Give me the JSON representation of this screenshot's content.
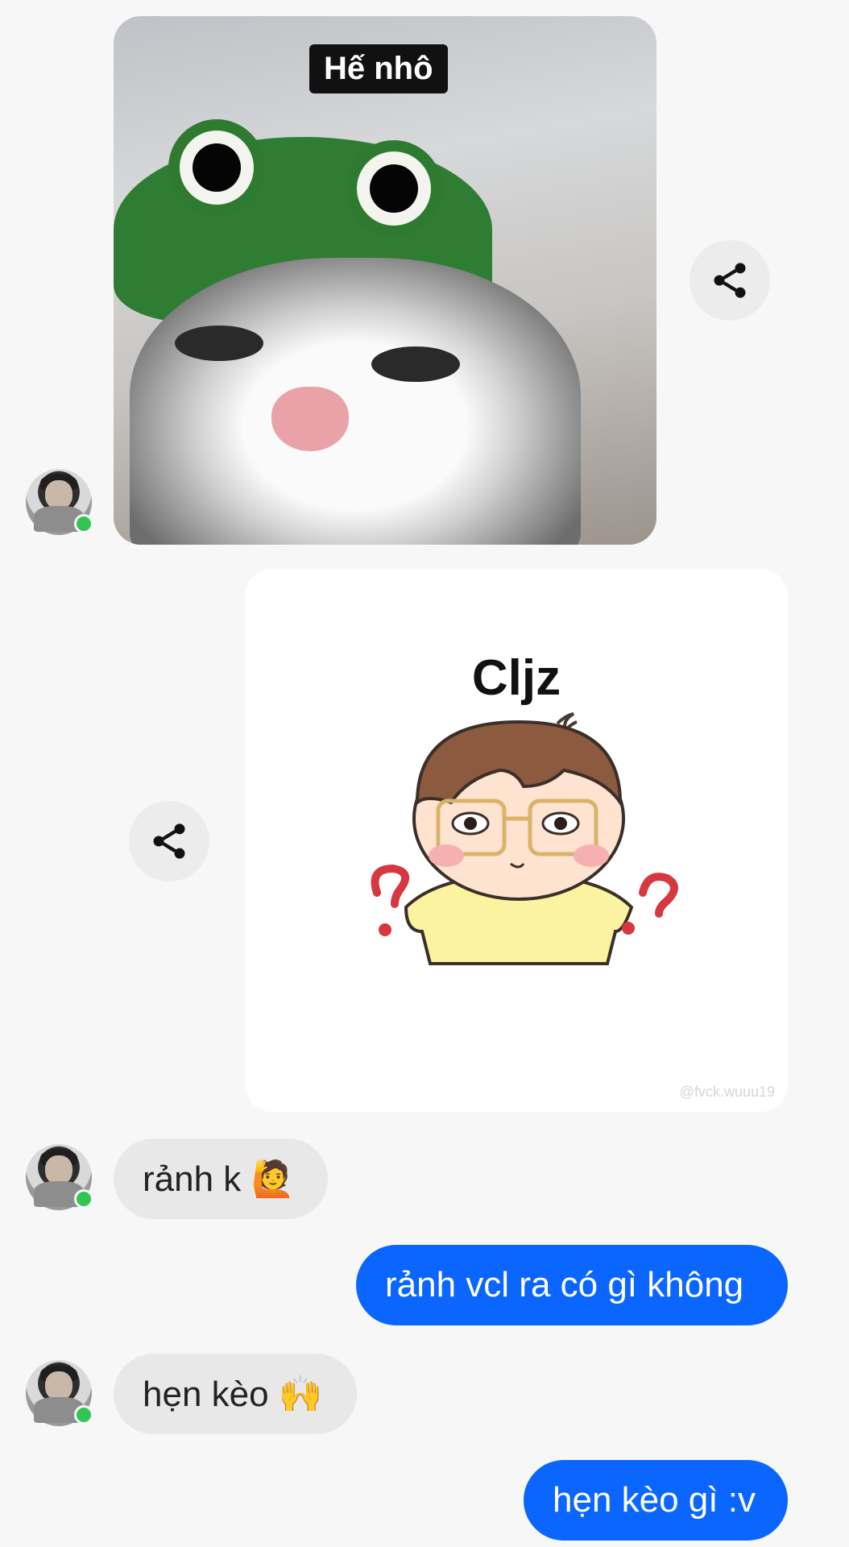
{
  "messages": {
    "m1_caption": "Hế nhô",
    "m2_title": "Cljz",
    "m2_watermark": "@fvck.wuuu19",
    "m3": "rảnh k 🙋",
    "m4": "rảnh vcl ra có gì không",
    "m5": "hẹn kèo 🙌",
    "m6": "hẹn kèo gì :v"
  },
  "icons": {
    "share": "share-icon",
    "online": "online-dot"
  },
  "colors": {
    "outgoing_bubble": "#0a66ff",
    "incoming_bubble": "#e8e8e8",
    "online": "#31c653"
  }
}
